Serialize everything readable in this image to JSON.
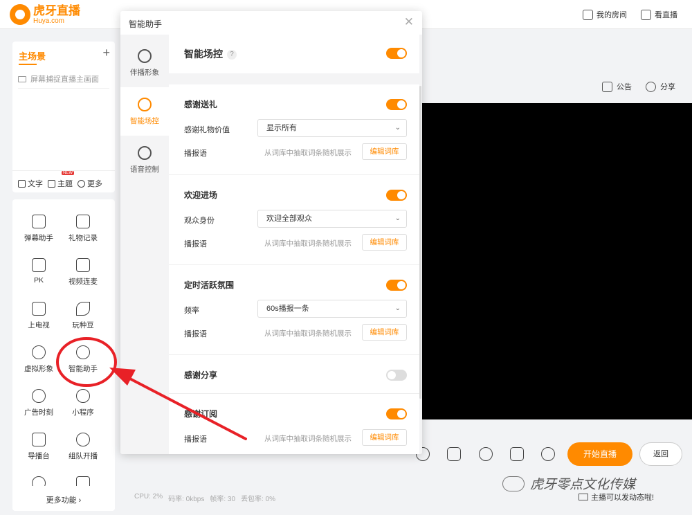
{
  "topbar": {
    "logo_cn": "虎牙直播",
    "logo_en": "Huya.com",
    "my_room": "我的房间",
    "watch": "看直播"
  },
  "scene": {
    "title": "主场景",
    "add": "+",
    "source": "屏幕捕捉直播主画面",
    "tools": [
      {
        "label": "文字",
        "icon": "text-icon"
      },
      {
        "label": "主题",
        "icon": "theme-icon",
        "badge": "NEW"
      },
      {
        "label": "更多",
        "icon": "more-icon"
      }
    ]
  },
  "tools": [
    {
      "label": "弹幕助手",
      "icon": "danmaku-icon"
    },
    {
      "label": "礼物记录",
      "icon": "gift-icon"
    },
    {
      "label": "PK",
      "icon": "pk-icon"
    },
    {
      "label": "视频连麦",
      "icon": "video-link-icon"
    },
    {
      "label": "上电视",
      "icon": "tv-icon"
    },
    {
      "label": "玩种豆",
      "icon": "leaf-icon"
    },
    {
      "label": "虚拟形象",
      "icon": "avatar-icon"
    },
    {
      "label": "智能助手",
      "icon": "robot-icon"
    },
    {
      "label": "广告时刻",
      "icon": "ad-icon"
    },
    {
      "label": "小程序",
      "icon": "miniapp-icon"
    },
    {
      "label": "导播台",
      "icon": "director-icon"
    },
    {
      "label": "组队开播",
      "icon": "team-icon"
    }
  ],
  "more_functions": "更多功能 ›",
  "preview": {
    "announce": "公告",
    "share": "分享"
  },
  "controls": {
    "start": "开始直播",
    "back": "返回"
  },
  "status": {
    "cpu": "CPU: 2%",
    "bitrate": "码率: 0kbps",
    "fps": "帧率: 30",
    "loss": "丢包率: 0%"
  },
  "watermark": "虎牙零点文化传媒",
  "broadcast_note": "主播可以发动态啦!",
  "dialog": {
    "title": "智能助手",
    "close": "✕",
    "sidebar": [
      {
        "label": "伴播形象",
        "icon": "companion-icon"
      },
      {
        "label": "智能场控",
        "icon": "headset-icon",
        "active": true
      },
      {
        "label": "语音控制",
        "icon": "mic-icon"
      }
    ],
    "header": {
      "title": "智能场控",
      "help": "?",
      "on": true
    },
    "sections": {
      "gift": {
        "title": "感谢送礼",
        "on": true,
        "value_label": "感谢礼物价值",
        "value_option": "显示所有",
        "speech_label": "播报语",
        "speech_hint": "从词库中抽取词条随机展示",
        "edit": "编辑词库"
      },
      "welcome": {
        "title": "欢迎进场",
        "on": true,
        "value_label": "观众身份",
        "value_option": "欢迎全部观众",
        "speech_label": "播报语",
        "speech_hint": "从词库中抽取词条随机展示",
        "edit": "编辑词库"
      },
      "timed": {
        "title": "定时活跃氛围",
        "on": true,
        "value_label": "频率",
        "value_option": "60s播报一条",
        "speech_label": "播报语",
        "speech_hint": "从词库中抽取词条随机展示",
        "edit": "编辑词库"
      },
      "share": {
        "title": "感谢分享",
        "on": false
      },
      "subscribe": {
        "title": "感谢订阅",
        "on": true,
        "speech_label": "播报语",
        "speech_hint": "从词库中抽取词条随机展示",
        "edit": "编辑词库"
      }
    }
  },
  "colors": {
    "accent": "#ff8a00",
    "annotation": "#e82127"
  }
}
